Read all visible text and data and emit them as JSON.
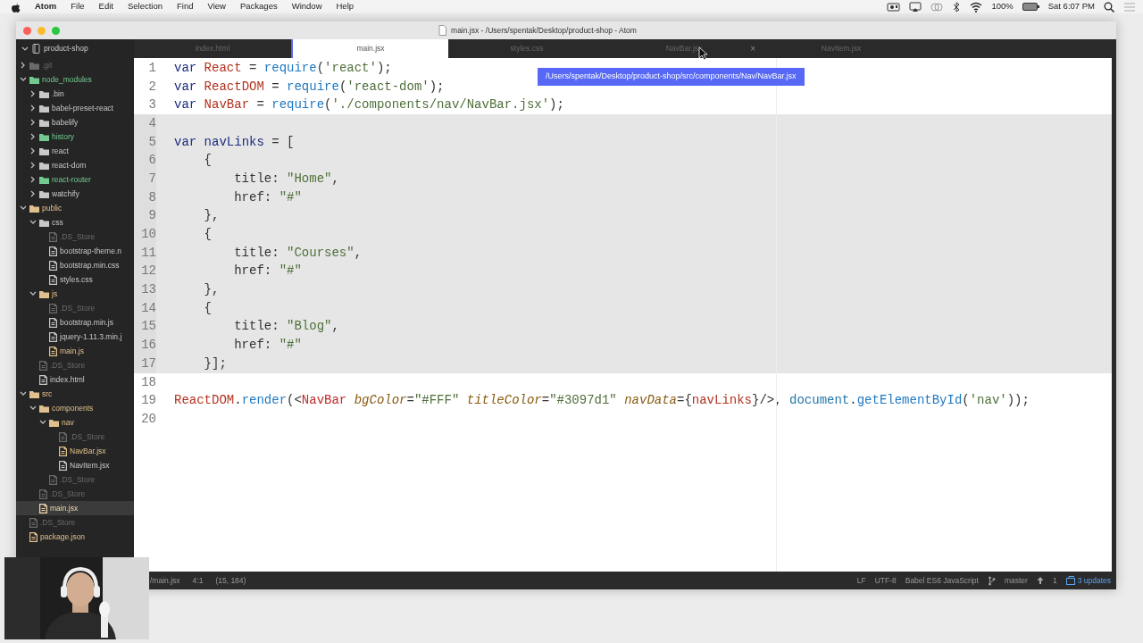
{
  "menubar": {
    "app": "Atom",
    "items": [
      "File",
      "Edit",
      "Selection",
      "Find",
      "View",
      "Packages",
      "Window",
      "Help"
    ],
    "battery": "100%",
    "clock": "Sat 6:07 PM"
  },
  "window": {
    "title": "main.jsx - /Users/spentak/Desktop/product-shop - Atom"
  },
  "tree": {
    "root": "product-shop",
    "items": [
      {
        "label": ".git",
        "kind": "folder",
        "color": "#6b6b6b",
        "expanded": false,
        "selected": false
      },
      {
        "label": "node_modules",
        "kind": "folder",
        "color": "#73c990",
        "expanded": true,
        "selected": false,
        "children": [
          {
            "label": ".bin",
            "kind": "folder",
            "color": "#c8c8c8",
            "expanded": false,
            "selected": false
          },
          {
            "label": "babel-preset-react",
            "kind": "folder",
            "color": "#c8c8c8",
            "expanded": false,
            "selected": false
          },
          {
            "label": "babelify",
            "kind": "folder",
            "color": "#c8c8c8",
            "expanded": false,
            "selected": false
          },
          {
            "label": "history",
            "kind": "folder",
            "color": "#73c990",
            "expanded": false,
            "selected": false
          },
          {
            "label": "react",
            "kind": "folder",
            "color": "#c8c8c8",
            "expanded": false,
            "selected": false
          },
          {
            "label": "react-dom",
            "kind": "folder",
            "color": "#c8c8c8",
            "expanded": false,
            "selected": false
          },
          {
            "label": "react-router",
            "kind": "folder",
            "color": "#73c990",
            "expanded": false,
            "selected": false
          },
          {
            "label": "watchify",
            "kind": "folder",
            "color": "#c8c8c8",
            "expanded": false,
            "selected": false
          }
        ]
      },
      {
        "label": "public",
        "kind": "folder",
        "color": "#e2c08d",
        "expanded": true,
        "selected": false,
        "children": [
          {
            "label": "css",
            "kind": "folder",
            "color": "#c8c8c8",
            "expanded": true,
            "selected": false,
            "children": [
              {
                "label": ".DS_Store",
                "kind": "file",
                "color": "#6b6b6b",
                "selected": false
              },
              {
                "label": "bootstrap-theme.n",
                "kind": "file",
                "color": "#c8c8c8",
                "selected": false
              },
              {
                "label": "bootstrap.min.css",
                "kind": "file",
                "color": "#c8c8c8",
                "selected": false
              },
              {
                "label": "styles.css",
                "kind": "file",
                "color": "#c8c8c8",
                "selected": false
              }
            ]
          },
          {
            "label": "js",
            "kind": "folder",
            "color": "#e2c08d",
            "expanded": true,
            "selected": false,
            "children": [
              {
                "label": ".DS_Store",
                "kind": "file",
                "color": "#6b6b6b",
                "selected": false
              },
              {
                "label": "bootstrap.min.js",
                "kind": "file",
                "color": "#c8c8c8",
                "selected": false
              },
              {
                "label": "jquery-1.11.3.min.j",
                "kind": "file",
                "color": "#c8c8c8",
                "selected": false
              },
              {
                "label": "main.js",
                "kind": "file",
                "color": "#e2c08d",
                "selected": false
              }
            ]
          },
          {
            "label": ".DS_Store",
            "kind": "file",
            "color": "#6b6b6b",
            "selected": false
          },
          {
            "label": "index.html",
            "kind": "file",
            "color": "#c8c8c8",
            "selected": false
          }
        ]
      },
      {
        "label": "src",
        "kind": "folder",
        "color": "#e2c08d",
        "expanded": true,
        "selected": false,
        "children": [
          {
            "label": "components",
            "kind": "folder",
            "color": "#e2c08d",
            "expanded": true,
            "selected": false,
            "children": [
              {
                "label": "nav",
                "kind": "folder",
                "color": "#e2c08d",
                "expanded": true,
                "selected": false,
                "children": [
                  {
                    "label": ".DS_Store",
                    "kind": "file",
                    "color": "#6b6b6b",
                    "selected": false
                  },
                  {
                    "label": "NavBar.jsx",
                    "kind": "file",
                    "color": "#e2c08d",
                    "selected": false
                  },
                  {
                    "label": "NavItem.jsx",
                    "kind": "file",
                    "color": "#c8c8c8",
                    "selected": false
                  }
                ]
              },
              {
                "label": ".DS_Store",
                "kind": "file",
                "color": "#6b6b6b",
                "selected": false
              }
            ]
          },
          {
            "label": ".DS_Store",
            "kind": "file",
            "color": "#6b6b6b",
            "selected": false
          },
          {
            "label": "main.jsx",
            "kind": "file",
            "color": "#f0d9ae",
            "selected": true
          }
        ]
      },
      {
        "label": ".DS_Store",
        "kind": "file",
        "color": "#6b6b6b",
        "selected": false
      },
      {
        "label": "package.json",
        "kind": "file",
        "color": "#e2c08d",
        "selected": false
      }
    ]
  },
  "tabs": [
    {
      "label": "index.html",
      "selected": false
    },
    {
      "label": "main.jsx",
      "selected": true
    },
    {
      "label": "styles.css",
      "selected": false
    },
    {
      "label": "NavBar.jsx",
      "selected": false,
      "close": "×"
    },
    {
      "label": "NavItem.jsx",
      "selected": false
    }
  ],
  "tooltip": "/Users/spentak/Desktop/product-shop/src/components/Nav/NavBar.jsx",
  "editor": {
    "lines": [
      {
        "number": "1",
        "selected": false,
        "tokens": [
          {
            "kind": "kw",
            "text": "var"
          },
          {
            "kind": "var",
            "text": " React"
          },
          {
            "kind": "plain",
            "text": " = "
          },
          {
            "kind": "fn",
            "text": "require"
          },
          {
            "kind": "plain",
            "text": "("
          },
          {
            "kind": "str",
            "text": "'react'"
          },
          {
            "kind": "plain",
            "text": ");"
          }
        ]
      },
      {
        "number": "2",
        "selected": false,
        "tokens": [
          {
            "kind": "kw",
            "text": "var"
          },
          {
            "kind": "var",
            "text": " ReactDOM"
          },
          {
            "kind": "plain",
            "text": " = "
          },
          {
            "kind": "fn",
            "text": "require"
          },
          {
            "kind": "plain",
            "text": "("
          },
          {
            "kind": "str",
            "text": "'react-dom'"
          },
          {
            "kind": "plain",
            "text": ");"
          }
        ]
      },
      {
        "number": "3",
        "selected": false,
        "tokens": [
          {
            "kind": "kw",
            "text": "var"
          },
          {
            "kind": "var",
            "text": " NavBar"
          },
          {
            "kind": "plain",
            "text": " = "
          },
          {
            "kind": "fn",
            "text": "require"
          },
          {
            "kind": "plain",
            "text": "("
          },
          {
            "kind": "str",
            "text": "'./components/nav/NavBar.jsx'"
          },
          {
            "kind": "plain",
            "text": ");"
          }
        ]
      },
      {
        "number": "4",
        "selected": true
      },
      {
        "number": "5",
        "selected": true,
        "tokens": [
          {
            "kind": "kw",
            "text": "var"
          },
          {
            "kind": "kw",
            "text": " navLinks"
          },
          {
            "kind": "plain",
            "text": " = ["
          }
        ]
      },
      {
        "number": "6",
        "selected": true,
        "tokens": [
          {
            "kind": "plain",
            "text": "    {"
          }
        ]
      },
      {
        "number": "7",
        "selected": true,
        "tokens": [
          {
            "kind": "plain",
            "text": "        title: "
          },
          {
            "kind": "str",
            "text": "\"Home\""
          },
          {
            "kind": "plain",
            "text": ","
          }
        ]
      },
      {
        "number": "8",
        "selected": true,
        "tokens": [
          {
            "kind": "plain",
            "text": "        href: "
          },
          {
            "kind": "str",
            "text": "\"#\""
          }
        ]
      },
      {
        "number": "9",
        "selected": true,
        "tokens": [
          {
            "kind": "plain",
            "text": "    },"
          }
        ]
      },
      {
        "number": "10",
        "selected": true,
        "tokens": [
          {
            "kind": "plain",
            "text": "    {"
          }
        ]
      },
      {
        "number": "11",
        "selected": true,
        "tokens": [
          {
            "kind": "plain",
            "text": "        title: "
          },
          {
            "kind": "str",
            "text": "\"Courses\""
          },
          {
            "kind": "plain",
            "text": ","
          }
        ]
      },
      {
        "number": "12",
        "selected": true,
        "tokens": [
          {
            "kind": "plain",
            "text": "        href: "
          },
          {
            "kind": "str",
            "text": "\"#\""
          }
        ]
      },
      {
        "number": "13",
        "selected": true,
        "tokens": [
          {
            "kind": "plain",
            "text": "    },"
          }
        ]
      },
      {
        "number": "14",
        "selected": true,
        "tokens": [
          {
            "kind": "plain",
            "text": "    {"
          }
        ]
      },
      {
        "number": "15",
        "selected": true,
        "tokens": [
          {
            "kind": "plain",
            "text": "        title: "
          },
          {
            "kind": "str",
            "text": "\"Blog\""
          },
          {
            "kind": "plain",
            "text": ","
          }
        ]
      },
      {
        "number": "16",
        "selected": true,
        "tokens": [
          {
            "kind": "plain",
            "text": "        href: "
          },
          {
            "kind": "str",
            "text": "\"#\""
          }
        ]
      },
      {
        "number": "17",
        "selected": true,
        "tokens": [
          {
            "kind": "plain",
            "text": "    }];"
          }
        ]
      },
      {
        "number": "18",
        "selected": false
      },
      {
        "number": "19",
        "selected": false,
        "tokens": [
          {
            "kind": "var",
            "text": "ReactDOM"
          },
          {
            "kind": "plain",
            "text": "."
          },
          {
            "kind": "fn",
            "text": "render"
          },
          {
            "kind": "plain",
            "text": "(<"
          },
          {
            "kind": "tag",
            "text": "NavBar"
          },
          {
            "kind": "attr",
            "text": " bgColor"
          },
          {
            "kind": "plain",
            "text": "="
          },
          {
            "kind": "str",
            "text": "\"#FFF\""
          },
          {
            "kind": "attr",
            "text": " titleColor"
          },
          {
            "kind": "plain",
            "text": "="
          },
          {
            "kind": "str",
            "text": "\"#3097d1\""
          },
          {
            "kind": "attr",
            "text": " navData"
          },
          {
            "kind": "plain",
            "text": "={"
          },
          {
            "kind": "var",
            "text": "navLinks"
          },
          {
            "kind": "plain",
            "text": "}/>, "
          },
          {
            "kind": "obj",
            "text": "document"
          },
          {
            "kind": "plain",
            "text": "."
          },
          {
            "kind": "fn",
            "text": "getElementById"
          },
          {
            "kind": "plain",
            "text": "("
          },
          {
            "kind": "str",
            "text": "'nav'"
          },
          {
            "kind": "plain",
            "text": "));"
          }
        ]
      },
      {
        "number": "20",
        "selected": false
      }
    ]
  },
  "status_bar": {
    "file": "/main.jsx",
    "cursor": "4:1",
    "selection": "(15, 184)",
    "line_ending": "LF",
    "encoding": "UTF-8",
    "grammar": "Babel ES6 JavaScript",
    "branch": "master",
    "ahead": "1",
    "updates": "3 updates"
  }
}
